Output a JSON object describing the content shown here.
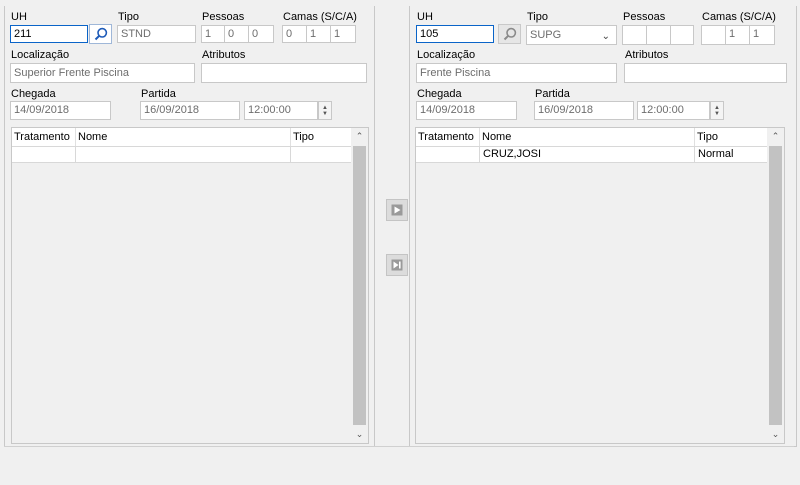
{
  "left": {
    "uh_label": "UH",
    "uh_value": "211",
    "tipo_label": "Tipo",
    "tipo_value": "STND",
    "pessoas_label": "Pessoas",
    "pessoas": [
      "1",
      "0",
      "0"
    ],
    "camas_label": "Camas (S/C/A)",
    "camas": [
      "0",
      "1",
      "1"
    ],
    "localizacao_label": "Localização",
    "localizacao_value": "Superior Frente Piscina",
    "atributos_label": "Atributos",
    "atributos_value": "",
    "chegada_label": "Chegada",
    "chegada_value": "14/09/2018",
    "partida_label": "Partida",
    "partida_value": "16/09/2018",
    "hora_value": "12:00:00",
    "grid": {
      "columns": [
        "Tratamento",
        "Nome",
        "Tipo"
      ],
      "rows": [
        [
          "",
          "",
          ""
        ]
      ]
    }
  },
  "right": {
    "uh_label": "UH",
    "uh_value": "105",
    "tipo_label": "Tipo",
    "tipo_value": "SUPG",
    "pessoas_label": "Pessoas",
    "pessoas": [
      "",
      "",
      ""
    ],
    "camas_label": "Camas (S/C/A)",
    "camas": [
      "",
      "1",
      "1"
    ],
    "localizacao_label": "Localização",
    "localizacao_value": "Frente Piscina",
    "atributos_label": "Atributos",
    "atributos_value": "",
    "chegada_label": "Chegada",
    "chegada_value": "14/09/2018",
    "partida_label": "Partida",
    "partida_value": "16/09/2018",
    "hora_value": "12:00:00",
    "grid": {
      "columns": [
        "Tratamento",
        "Nome",
        "Tipo"
      ],
      "rows": [
        [
          "",
          "CRUZ,JOSI",
          "Normal"
        ]
      ]
    }
  },
  "icons": {
    "search": "search-icon",
    "move_one": "play-icon",
    "move_all": "skip-end-icon"
  },
  "colors": {
    "accent": "#0a64c8",
    "disabled_text": "#6d6d6d"
  }
}
